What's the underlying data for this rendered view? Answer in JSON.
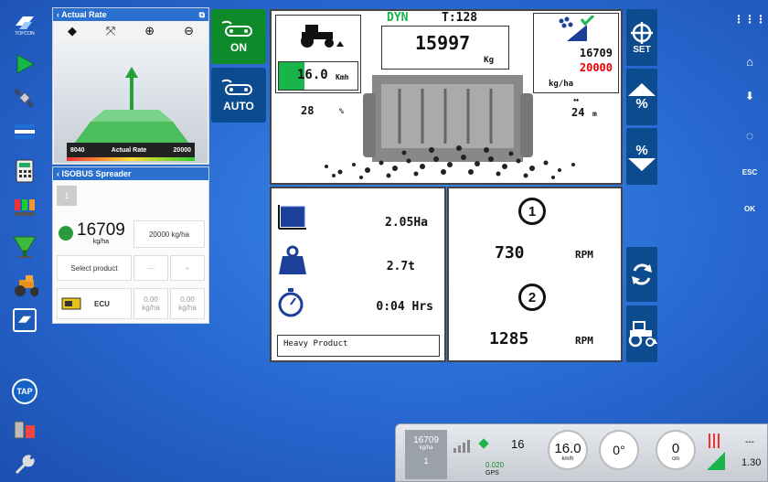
{
  "left_strip": {
    "icons": [
      "brand-logo",
      "guidance",
      "satellite",
      "field-data",
      "calculator",
      "section-control",
      "spreader",
      "tractor",
      "active-app-logo",
      "tap",
      "storage",
      "tools"
    ],
    "brand_caption": "TOPCON",
    "tap_label": "TAP"
  },
  "actual_rate_panel": {
    "title": "Actual Rate",
    "bar_min": "8040",
    "bar_label": "Actual Rate",
    "bar_max": "20000"
  },
  "isobus_panel": {
    "title": "ISOBUS Spreader",
    "section_number": "1",
    "rate_value": "16709",
    "rate_unit": "kg/ha",
    "target_rate": "20000 kg/ha",
    "select_product": "Select product",
    "ecu_label": "ECU",
    "col1_value": "0.00",
    "col1_unit": "kg/ha",
    "col2_value": "0.00",
    "col2_unit": "kg/ha"
  },
  "side_buttons": {
    "on_label": "ON",
    "auto_label": "AUTO",
    "on_color": "#0f8a2b",
    "auto_color": "#0d4b8f"
  },
  "main_display": {
    "mode": "DYN",
    "timer": "T:128",
    "weight": "15997",
    "weight_unit": "Kg",
    "speed": "16.0",
    "speed_unit": "Kmh",
    "angle": "28",
    "angle_unit": "%",
    "rate_actual": "16709",
    "rate_target": "20000",
    "rate_unit": "kg/ha",
    "width": "24",
    "width_unit": "m",
    "area": "2.05Ha",
    "product_weight": "2.7t",
    "time": "0:04 Hrs",
    "product_name": "Heavy Product",
    "disc1_number": "1",
    "disc1_rpm": "730",
    "disc2_number": "2",
    "disc2_rpm": "1285",
    "rpm_unit": "RPM"
  },
  "right_buttons": {
    "set_label": "SET",
    "percent_label": "%"
  },
  "right_strip": {
    "esc_label": "ESC",
    "ok_label": "OK"
  },
  "status_bar": {
    "rate": "16709",
    "rate_unit": "kg/ha",
    "section": "1",
    "satellites": "16",
    "accuracy": "0.020",
    "gps_label": "GPS",
    "speed": "16.0",
    "speed_unit": "km/h",
    "heading": "0°",
    "offset": "0",
    "offset_unit": "cm",
    "dashes": "---",
    "value_right": "1.30"
  }
}
